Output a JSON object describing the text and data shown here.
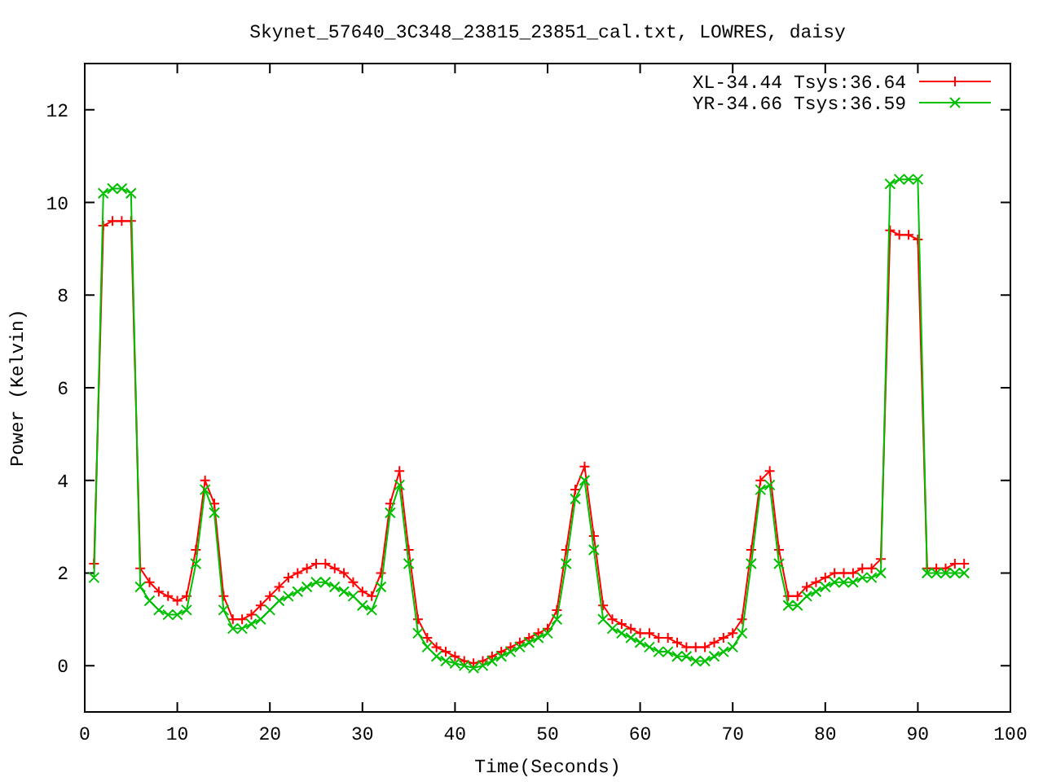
{
  "chart_data": {
    "type": "line",
    "title": "Skynet_57640_3C348_23815_23851_cal.txt, LOWRES, daisy",
    "xlabel": "Time(Seconds)",
    "ylabel": "Power (Kelvin)",
    "legend": "top right",
    "xlim": [
      0,
      100
    ],
    "ylim": [
      -1,
      13
    ],
    "xticks": [
      0,
      10,
      20,
      30,
      40,
      50,
      60,
      70,
      80,
      90,
      100
    ],
    "yticks": [
      0,
      2,
      4,
      6,
      8,
      10,
      12
    ],
    "x": [
      1,
      2,
      3,
      4,
      5,
      6,
      7,
      8,
      9,
      10,
      11,
      12,
      13,
      14,
      15,
      16,
      17,
      18,
      19,
      20,
      21,
      22,
      23,
      24,
      25,
      26,
      27,
      28,
      29,
      30,
      31,
      32,
      33,
      34,
      35,
      36,
      37,
      38,
      39,
      40,
      41,
      42,
      43,
      44,
      45,
      46,
      47,
      48,
      49,
      50,
      51,
      52,
      53,
      54,
      55,
      56,
      57,
      58,
      59,
      60,
      61,
      62,
      63,
      64,
      65,
      66,
      67,
      68,
      69,
      70,
      71,
      72,
      73,
      74,
      75,
      76,
      77,
      78,
      79,
      80,
      81,
      82,
      83,
      84,
      85,
      86,
      87,
      88,
      89,
      90,
      91,
      92,
      93,
      94,
      95
    ],
    "series": [
      {
        "name": "XL-34.44 Tsys:36.64",
        "color": "#ff0000",
        "marker": "+",
        "values": [
          2.2,
          9.5,
          9.6,
          9.6,
          9.6,
          2.1,
          1.8,
          1.6,
          1.5,
          1.4,
          1.5,
          2.5,
          4.0,
          3.5,
          1.5,
          1.0,
          1.0,
          1.1,
          1.3,
          1.5,
          1.7,
          1.9,
          2.0,
          2.1,
          2.2,
          2.2,
          2.1,
          2.0,
          1.8,
          1.6,
          1.5,
          2.0,
          3.5,
          4.2,
          2.5,
          1.0,
          0.6,
          0.4,
          0.3,
          0.2,
          0.1,
          0.05,
          0.1,
          0.2,
          0.3,
          0.4,
          0.5,
          0.6,
          0.7,
          0.8,
          1.2,
          2.5,
          3.8,
          4.3,
          2.8,
          1.3,
          1.0,
          0.9,
          0.8,
          0.7,
          0.7,
          0.6,
          0.6,
          0.5,
          0.4,
          0.4,
          0.4,
          0.5,
          0.6,
          0.7,
          1.0,
          2.5,
          4.0,
          4.2,
          2.5,
          1.5,
          1.5,
          1.7,
          1.8,
          1.9,
          2.0,
          2.0,
          2.0,
          2.1,
          2.1,
          2.3,
          9.4,
          9.3,
          9.3,
          9.2,
          2.1,
          2.1,
          2.1,
          2.2,
          2.2
        ]
      },
      {
        "name": "YR-34.66 Tsys:36.59",
        "color": "#00c000",
        "marker": "x",
        "values": [
          1.9,
          10.2,
          10.3,
          10.3,
          10.2,
          1.7,
          1.4,
          1.2,
          1.1,
          1.1,
          1.2,
          2.2,
          3.8,
          3.3,
          1.2,
          0.8,
          0.8,
          0.9,
          1.0,
          1.2,
          1.4,
          1.5,
          1.6,
          1.7,
          1.8,
          1.8,
          1.7,
          1.6,
          1.5,
          1.3,
          1.2,
          1.7,
          3.3,
          3.9,
          2.2,
          0.7,
          0.4,
          0.2,
          0.1,
          0.05,
          0.0,
          -0.05,
          0.0,
          0.1,
          0.2,
          0.3,
          0.4,
          0.5,
          0.6,
          0.7,
          1.0,
          2.2,
          3.6,
          4.0,
          2.5,
          1.0,
          0.8,
          0.7,
          0.6,
          0.5,
          0.4,
          0.3,
          0.3,
          0.2,
          0.2,
          0.1,
          0.1,
          0.2,
          0.3,
          0.4,
          0.7,
          2.2,
          3.8,
          3.9,
          2.2,
          1.3,
          1.3,
          1.5,
          1.6,
          1.7,
          1.8,
          1.8,
          1.8,
          1.9,
          1.9,
          2.0,
          10.4,
          10.5,
          10.5,
          10.5,
          2.0,
          2.0,
          2.0,
          2.0,
          2.0
        ]
      }
    ]
  }
}
